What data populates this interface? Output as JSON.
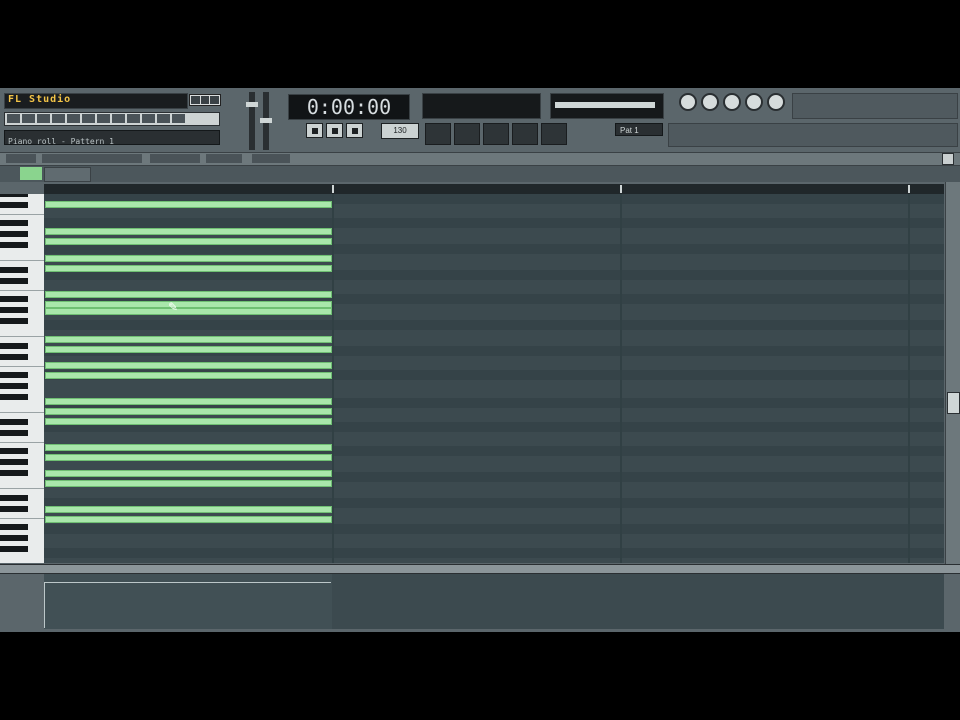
{
  "menu": {
    "label": "FL Studio"
  },
  "transport": {
    "time": "0:00:00",
    "tempo": "130"
  },
  "pattern": {
    "label": "Pat 1"
  },
  "hint": {
    "title": "Piano roll - Pattern 1"
  },
  "piano_roll": {
    "note_count": 22
  },
  "colors": {
    "note": "#a9e7ab",
    "background": "#3c4a4f",
    "accent": "#8ad48e"
  },
  "icons": [
    "play-icon",
    "stop-icon",
    "record-icon",
    "pencil-icon",
    "scissors-icon",
    "magnet-icon"
  ]
}
